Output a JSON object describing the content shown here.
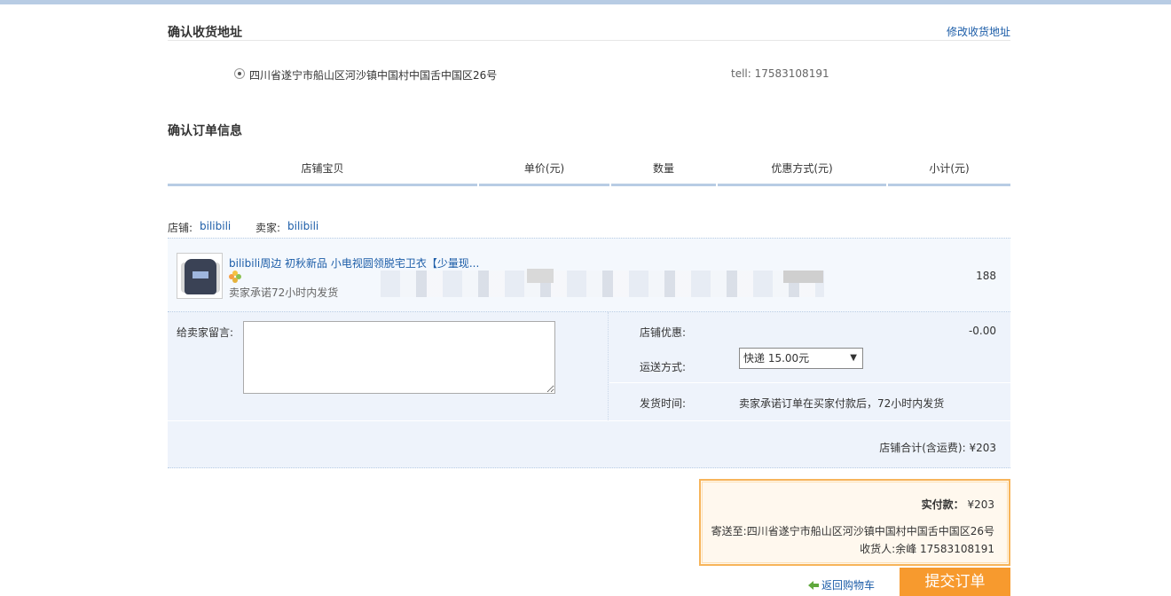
{
  "address_section": {
    "title": "确认收货地址",
    "edit_link": "修改收货地址",
    "address": "四川省遂宁市船山区河沙镇中国村中国舌中国区26号",
    "tell": "tell:  17583108191"
  },
  "order_section": {
    "title": "确认订单信息",
    "columns": [
      "店铺宝贝",
      "单价(元)",
      "数量",
      "优惠方式(元)",
      "小计(元)"
    ]
  },
  "shop": {
    "shop_label": "店铺:",
    "shop_name": "bilibili",
    "seller_label": "卖家:",
    "seller_name": "bilibili"
  },
  "item": {
    "title": "bilibili周边 初秋新品 小电视圆领脱宅卫衣【少量现...",
    "promise": "卖家承诺72小时内发货",
    "subtotal": "188"
  },
  "message": {
    "label": "给卖家留言:",
    "value": ""
  },
  "shop_discount": {
    "label": "店铺优惠:",
    "value": "-0.00"
  },
  "shipping": {
    "label": "运送方式:",
    "selected": "快递 15.00元"
  },
  "send_time": {
    "label": "发货时间:",
    "value": "卖家承诺订单在买家付款后，72小时内发货"
  },
  "shop_total": "店铺合计(含运费): ¥203",
  "payment": {
    "actual_label": "实付款：",
    "actual_value": "¥203",
    "ship_to": "寄送至:四川省遂宁市船山区河沙镇中国村中国舌中国区26号",
    "receiver": "收货人:余峰 17583108191"
  },
  "footer": {
    "back_cart": "返回购物车",
    "submit": "提交订单"
  },
  "colors": {
    "accent_blue": "#1c5da8",
    "header_line": "#b8cce4",
    "submit_orange": "#f79a2e",
    "pay_border": "#f7b45a"
  },
  "icons": [
    "radio-selected-icon",
    "product-thumbnail",
    "badge-icon",
    "dropdown-arrow-icon",
    "back-arrow-icon"
  ]
}
